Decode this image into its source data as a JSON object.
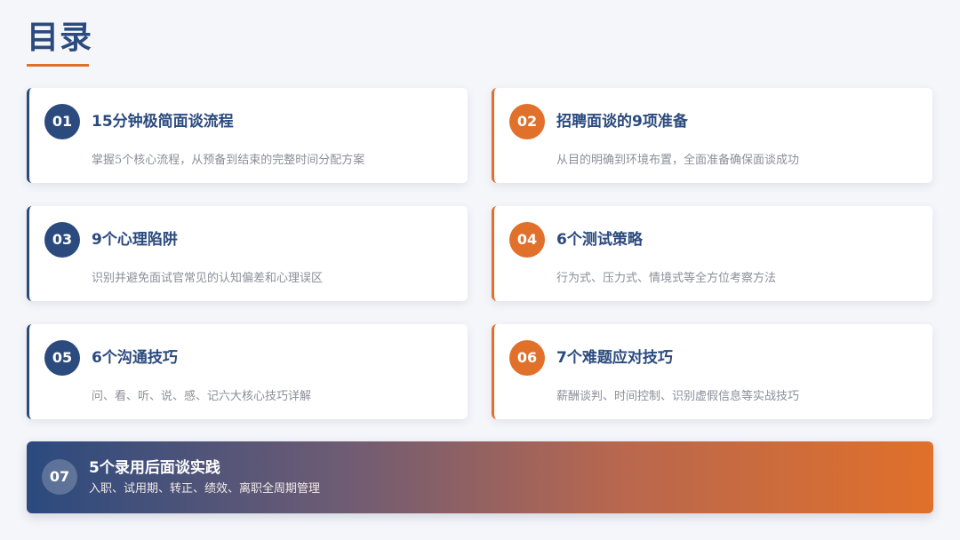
{
  "title": "目录",
  "colors": {
    "navy": "#2b4a7e",
    "orange": "#e0702a",
    "background": "#f5f6fa"
  },
  "items": [
    {
      "num": "01",
      "title": "15分钟极简面谈流程",
      "desc": "掌握5个核心流程，从预备到结束的完整时间分配方案",
      "accent": "navy"
    },
    {
      "num": "02",
      "title": "招聘面谈的9项准备",
      "desc": "从目的明确到环境布置，全面准备确保面谈成功",
      "accent": "orange"
    },
    {
      "num": "03",
      "title": "9个心理陷阱",
      "desc": "识别并避免面试官常见的认知偏差和心理误区",
      "accent": "navy"
    },
    {
      "num": "04",
      "title": "6个测试策略",
      "desc": "行为式、压力式、情境式等全方位考察方法",
      "accent": "orange"
    },
    {
      "num": "05",
      "title": "6个沟通技巧",
      "desc": "问、看、听、说、感、记六大核心技巧详解",
      "accent": "navy"
    },
    {
      "num": "06",
      "title": "7个难题应对技巧",
      "desc": "薪酬谈判、时间控制、识别虚假信息等实战技巧",
      "accent": "orange"
    }
  ],
  "banner": {
    "num": "07",
    "title": "5个录用后面谈实践",
    "desc": "入职、试用期、转正、绩效、离职全周期管理"
  }
}
